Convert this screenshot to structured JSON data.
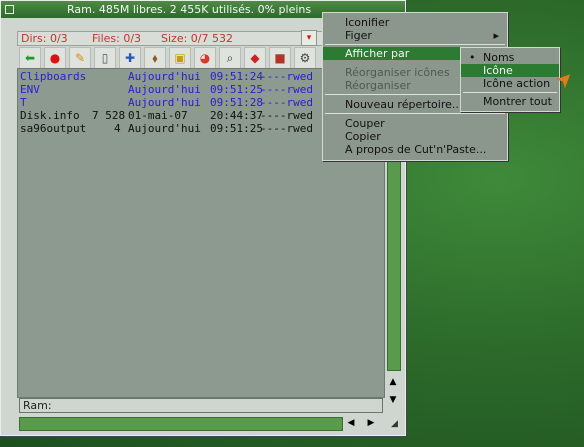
{
  "window": {
    "title": "Ram.  485M libres. 2 455K utilisés. 0% pleins",
    "close_box": "close-box"
  },
  "info": {
    "dirs": "Dirs: 0/3",
    "files": "Files: 0/3",
    "size": "Size: 0/7 532",
    "arrow": "▾"
  },
  "toolbar": {
    "icons": [
      "back-arrow-icon",
      "info-icon",
      "pencil-icon",
      "page-icon",
      "move-icon",
      "tag-icon",
      "select-box-icon",
      "pie-icon",
      "search-icon",
      "diamond-icon",
      "photo-icon",
      "tool-icon"
    ]
  },
  "list": {
    "rows": [
      {
        "name": "Clipboards",
        "size": "",
        "date": "Aujourd'hui",
        "time": "09:51:24",
        "prot": "----rwed",
        "type": "dir"
      },
      {
        "name": "ENV",
        "size": "",
        "date": "Aujourd'hui",
        "time": "09:51:25",
        "prot": "----rwed",
        "type": "dir"
      },
      {
        "name": "T",
        "size": "",
        "date": "Aujourd'hui",
        "time": "09:51:28",
        "prot": "----rwed",
        "type": "dir"
      },
      {
        "name": "Disk.info",
        "size": "7 528",
        "date": "01-mai-07",
        "time": "20:44:37",
        "prot": "----rwed",
        "type": "file"
      },
      {
        "name": "sa96output",
        "size": "4",
        "date": "Aujourd'hui",
        "time": "09:51:25",
        "prot": "----rwed",
        "type": "file"
      }
    ]
  },
  "status": {
    "path": "Ram:"
  },
  "menu": {
    "items": [
      {
        "label": "Iconifier",
        "state": "normal"
      },
      {
        "label": "Figer",
        "state": "normal",
        "submenu": true
      },
      {
        "label": "Afficher par",
        "state": "selected",
        "submenu": true
      },
      {
        "label": "Réorganiser icônes",
        "state": "disabled"
      },
      {
        "label": "Réorganiser",
        "state": "disabled"
      },
      {
        "label": "Nouveau répertoire...",
        "state": "normal"
      },
      {
        "label": "Couper",
        "state": "normal"
      },
      {
        "label": "Copier",
        "state": "normal"
      },
      {
        "label": "A propos de Cut'n'Paste...",
        "state": "normal"
      }
    ],
    "submenu_mark": "▸"
  },
  "submenu": {
    "items": [
      {
        "label": "Noms",
        "state": "checked",
        "mark": "•"
      },
      {
        "label": "Icône",
        "state": "selected"
      },
      {
        "label": "Icône action",
        "state": "normal"
      },
      {
        "label": "Montrer tout",
        "state": "normal"
      }
    ]
  },
  "colors": {
    "accent": "#2d7a33",
    "dir_text": "#2b1cd4",
    "info_text": "#c0352c"
  }
}
